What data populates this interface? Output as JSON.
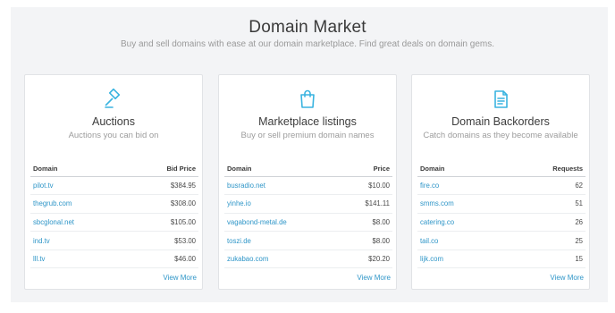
{
  "header": {
    "title": "Domain Market",
    "subtitle": "Buy and sell domains with ease at our domain marketplace. Find great deals on domain gems."
  },
  "colors": {
    "accent": "#2f96c8",
    "icon": "#3ab4e0",
    "background": "#f3f4f6"
  },
  "cards": [
    {
      "icon": "gavel-icon",
      "title": "Auctions",
      "subtitle": "Auctions you can bid on",
      "col1": "Domain",
      "col2": "Bid Price",
      "rows": [
        {
          "domain": "pilot.tv",
          "value": "$384.95"
        },
        {
          "domain": "thegrub.com",
          "value": "$308.00"
        },
        {
          "domain": "sbcglonal.net",
          "value": "$105.00"
        },
        {
          "domain": "ind.tv",
          "value": "$53.00"
        },
        {
          "domain": "lll.tv",
          "value": "$46.00"
        }
      ],
      "view_more": "View More"
    },
    {
      "icon": "shopping-bag-icon",
      "title": "Marketplace listings",
      "subtitle": "Buy or sell premium domain names",
      "col1": "Domain",
      "col2": "Price",
      "rows": [
        {
          "domain": "busradio.net",
          "value": "$10.00"
        },
        {
          "domain": "yinhe.io",
          "value": "$141.11"
        },
        {
          "domain": "vagabond-metal.de",
          "value": "$8.00"
        },
        {
          "domain": "toszi.de",
          "value": "$8.00"
        },
        {
          "domain": "zukabao.com",
          "value": "$20.20"
        }
      ],
      "view_more": "View More"
    },
    {
      "icon": "document-icon",
      "title": "Domain Backorders",
      "subtitle": "Catch domains as they become available",
      "col1": "Domain",
      "col2": "Requests",
      "rows": [
        {
          "domain": "fire.co",
          "value": "62"
        },
        {
          "domain": "smms.com",
          "value": "51"
        },
        {
          "domain": "catering.co",
          "value": "26"
        },
        {
          "domain": "tail.co",
          "value": "25"
        },
        {
          "domain": "lijk.com",
          "value": "15"
        }
      ],
      "view_more": "View More"
    }
  ]
}
